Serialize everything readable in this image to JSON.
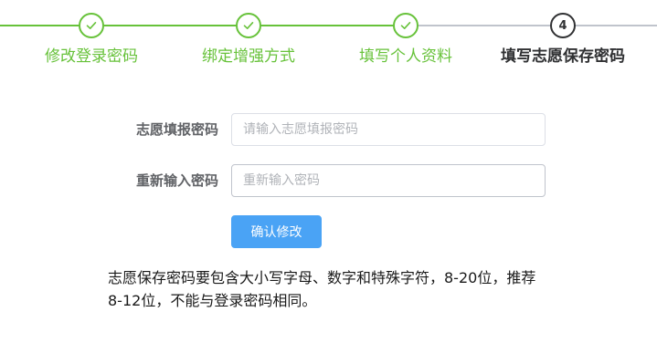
{
  "steps": [
    {
      "label": "修改登录密码",
      "status": "done"
    },
    {
      "label": "绑定增强方式",
      "status": "done"
    },
    {
      "label": "填写个人资料",
      "status": "done"
    },
    {
      "label": "填写志愿保存密码",
      "status": "active",
      "number": "4"
    }
  ],
  "form": {
    "password": {
      "label": "志愿填报密码",
      "placeholder": "请输入志愿填报密码",
      "value": ""
    },
    "confirm": {
      "label": "重新输入密码",
      "placeholder": "重新输入密码",
      "value": ""
    },
    "submit_label": "确认修改"
  },
  "hint": "志愿保存密码要包含大小写字母、数字和特殊字符，8-20位，推荐8-12位，不能与登录密码相同。",
  "colors": {
    "done": "#67c23a",
    "active": "#303133",
    "primary_button": "#4aa3f5",
    "pending_line": "#c0c4cc"
  },
  "icons": {
    "done_step": "check-icon"
  }
}
